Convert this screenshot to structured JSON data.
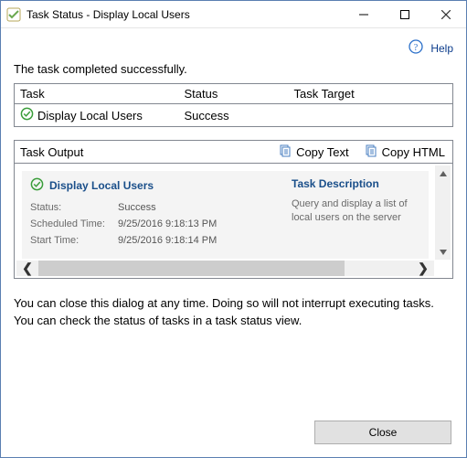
{
  "window": {
    "title": "Task Status - Display Local Users"
  },
  "help": {
    "label": "Help"
  },
  "message": "The task completed successfully.",
  "summary": {
    "headers": {
      "task": "Task",
      "status": "Status",
      "target": "Task Target"
    },
    "row": {
      "task": "Display Local Users",
      "status": "Success",
      "target": ""
    }
  },
  "output": {
    "header": "Task Output",
    "copy_text": "Copy Text",
    "copy_html": "Copy HTML",
    "task_name": "Display Local Users",
    "fields": {
      "status_label": "Status:",
      "status_value": "Success",
      "scheduled_label": "Scheduled Time:",
      "scheduled_value": "9/25/2016 9:18:13 PM",
      "start_label": "Start Time:",
      "start_value": "9/25/2016 9:18:14 PM"
    },
    "desc_title": "Task Description",
    "desc_text": "Query and display a list of local users on the server"
  },
  "hint": "You can close this dialog at any time. Doing so will not interrupt executing tasks. You can check the status of tasks in a task status view.",
  "buttons": {
    "close": "Close"
  }
}
